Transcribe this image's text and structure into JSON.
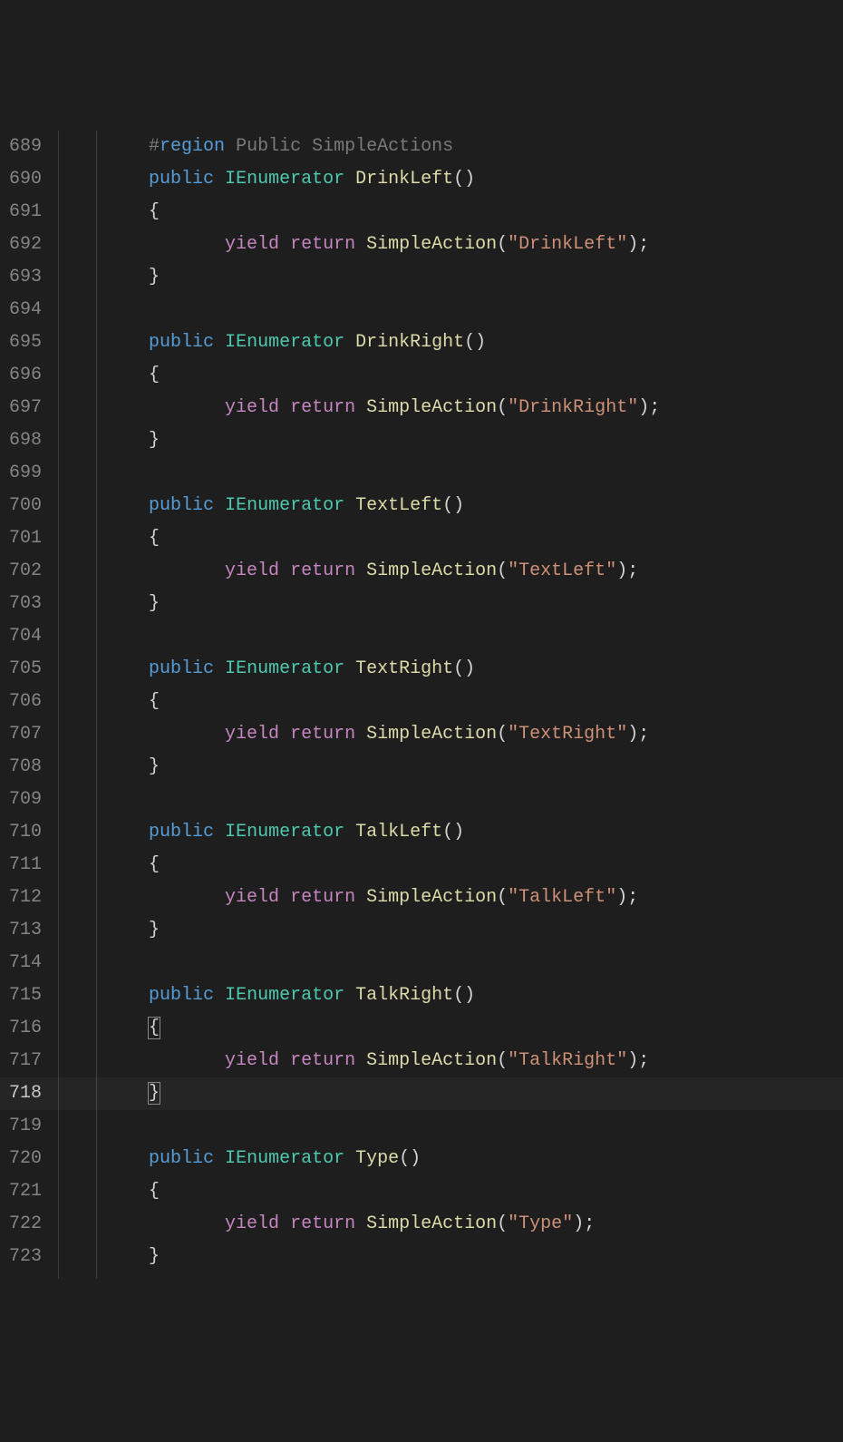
{
  "lineNumbers": [
    "689",
    "690",
    "691",
    "692",
    "693",
    "694",
    "695",
    "696",
    "697",
    "698",
    "699",
    "700",
    "701",
    "702",
    "703",
    "704",
    "705",
    "706",
    "707",
    "708",
    "709",
    "710",
    "711",
    "712",
    "713",
    "714",
    "715",
    "716",
    "717",
    "718",
    "719",
    "720",
    "721",
    "722",
    "723"
  ],
  "activeLineNumber": "718",
  "modifiedStart": 30,
  "modifiedCount": 5,
  "region": {
    "hash": "#",
    "kw": "region",
    "rest": " Public SimpleActions"
  },
  "kw": {
    "public": "public",
    "yield": "yield",
    "return": "return"
  },
  "type": "IEnumerator",
  "call": "SimpleAction",
  "punc": {
    "openParen": "(",
    "closeParen": ")",
    "openBrace": "{",
    "closeBrace": "}",
    "semi": ";",
    "q": "\""
  },
  "methods": [
    {
      "name": "DrinkLeft",
      "arg": "DrinkLeft"
    },
    {
      "name": "DrinkRight",
      "arg": "DrinkRight"
    },
    {
      "name": "TextLeft",
      "arg": "TextLeft"
    },
    {
      "name": "TextRight",
      "arg": "TextRight"
    },
    {
      "name": "TalkLeft",
      "arg": "TalkLeft"
    },
    {
      "name": "TalkRight",
      "arg": "TalkRight"
    },
    {
      "name": "Type",
      "arg": "Type"
    }
  ]
}
